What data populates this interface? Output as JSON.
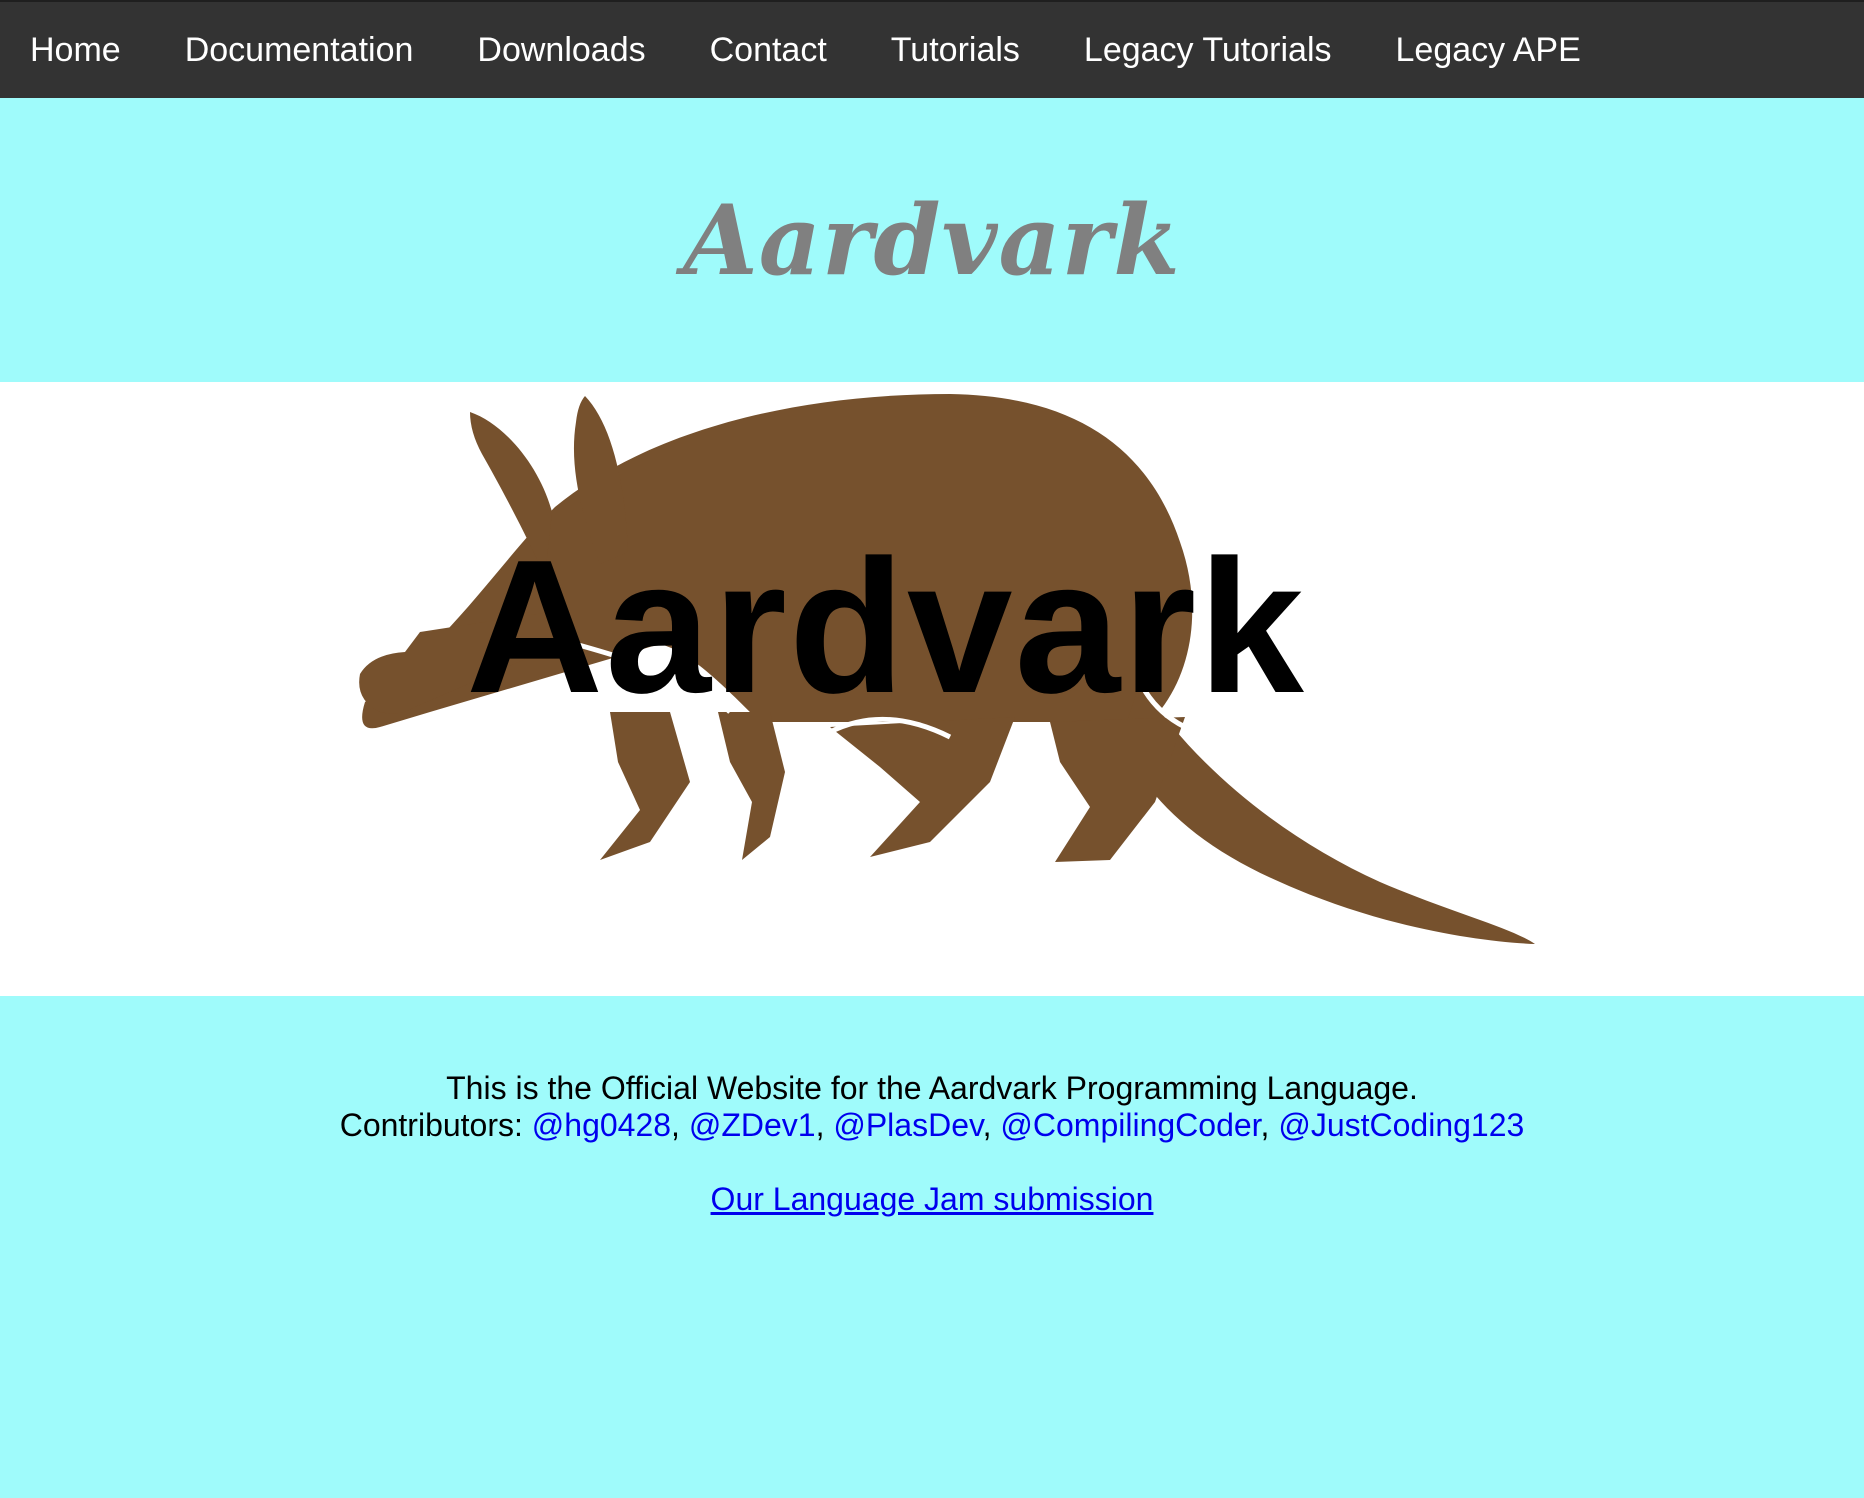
{
  "nav": {
    "items": [
      {
        "label": "Home"
      },
      {
        "label": "Documentation"
      },
      {
        "label": "Downloads"
      },
      {
        "label": "Contact"
      },
      {
        "label": "Tutorials"
      },
      {
        "label": "Legacy Tutorials"
      },
      {
        "label": "Legacy APE"
      }
    ]
  },
  "header": {
    "title": "Aardvark"
  },
  "banner": {
    "logo_text": "Aardvark",
    "colors": {
      "animal": "#76512d",
      "background": "#ffffff"
    }
  },
  "content": {
    "description": "This is the Official Website for the Aardvark Programming Language.",
    "contributors_label": "Contributors:",
    "contributors": [
      "@hg0428",
      "@ZDev1",
      "@PlasDev",
      "@CompilingCoder",
      "@JustCoding123"
    ],
    "separator": ",",
    "jam_link": "Our Language Jam submission"
  },
  "colors": {
    "navbar": "#333333",
    "page_background": "#9ffbfb",
    "title": "#808080",
    "link": "#0000ee"
  }
}
